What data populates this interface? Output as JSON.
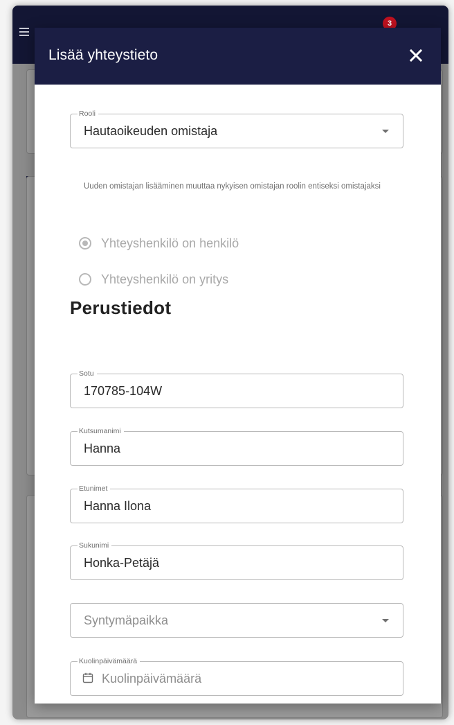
{
  "background": {
    "notification_count": "3"
  },
  "modal": {
    "title": "Lisää yhteystieto",
    "close_icon": "close-icon"
  },
  "role_field": {
    "legend": "Rooli",
    "value": "Hautaoikeuden omistaja",
    "helper": "Uuden omistajan lisääminen muuttaa nykyisen omistajan roolin entiseksi omistajaksi"
  },
  "contact_type": {
    "options": [
      {
        "label": "Yhteyshenkilö on henkilö",
        "checked": true
      },
      {
        "label": "Yhteyshenkilö on yritys",
        "checked": false
      }
    ]
  },
  "section": {
    "heading": "Perustiedot"
  },
  "fields": {
    "sotu": {
      "legend": "Sotu",
      "value": "170785-104W"
    },
    "kutsumanimi": {
      "legend": "Kutsumanimi",
      "value": "Hanna"
    },
    "etunimet": {
      "legend": "Etunimet",
      "value": "Hanna Ilona"
    },
    "sukunimi": {
      "legend": "Sukunimi",
      "value": "Honka-Petäjä"
    },
    "syntymapaikka": {
      "placeholder": "Syntymäpaikka"
    },
    "kuolinpaiva": {
      "legend": "Kuolinpäivämäärä",
      "placeholder": "Kuolinpäivämäärä",
      "icon": "calendar-icon"
    }
  },
  "colors": {
    "header": "#1b1e44",
    "badge": "#c0111f"
  }
}
